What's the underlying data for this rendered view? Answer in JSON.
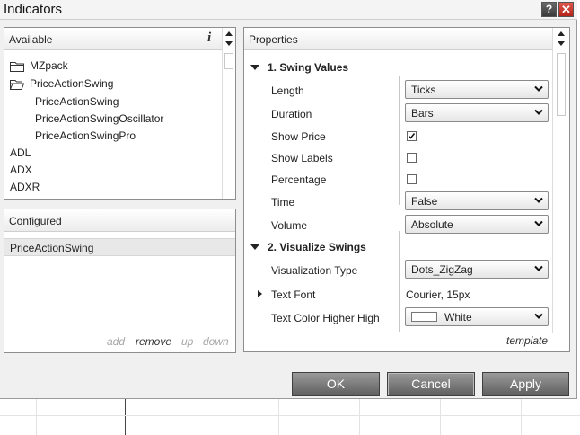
{
  "window": {
    "title": "Indicators",
    "help_glyph": "?",
    "close_glyph": "✕"
  },
  "available": {
    "header": "Available",
    "info_glyph": "i",
    "items": [
      {
        "label": "MZpack",
        "type": "folder-closed"
      },
      {
        "label": "PriceActionSwing",
        "type": "folder-open"
      },
      {
        "label": "PriceActionSwing",
        "type": "child"
      },
      {
        "label": "PriceActionSwingOscillator",
        "type": "child"
      },
      {
        "label": "PriceActionSwingPro",
        "type": "child"
      },
      {
        "label": "ADL",
        "type": "item"
      },
      {
        "label": "ADX",
        "type": "item"
      },
      {
        "label": "ADXR",
        "type": "item"
      }
    ]
  },
  "configured": {
    "header": "Configured",
    "selected": "PriceActionSwing",
    "actions": {
      "add": "add",
      "remove": "remove",
      "up": "up",
      "down": "down"
    }
  },
  "properties": {
    "header": "Properties",
    "section1": "1. Swing Values",
    "length_label": "Length",
    "length_value": "Ticks",
    "duration_label": "Duration",
    "duration_value": "Bars",
    "show_price_label": "Show Price",
    "show_price_checked": true,
    "show_labels_label": "Show Labels",
    "show_labels_checked": false,
    "percentage_label": "Percentage",
    "percentage_checked": false,
    "time_label": "Time",
    "time_value": "False",
    "volume_label": "Volume",
    "volume_value": "Absolute",
    "section2": "2. Visualize Swings",
    "vis_type_label": "Visualization Type",
    "vis_type_value": "Dots_ZigZag",
    "text_font_label": "Text Font",
    "text_font_value": "Courier, 15px",
    "text_color_hh_label": "Text Color Higher High",
    "text_color_hh_value": "White",
    "text_color_hh_swatch": "#ffffff",
    "template_link": "template"
  },
  "buttons": {
    "ok": "OK",
    "cancel": "Cancel",
    "apply": "Apply"
  }
}
